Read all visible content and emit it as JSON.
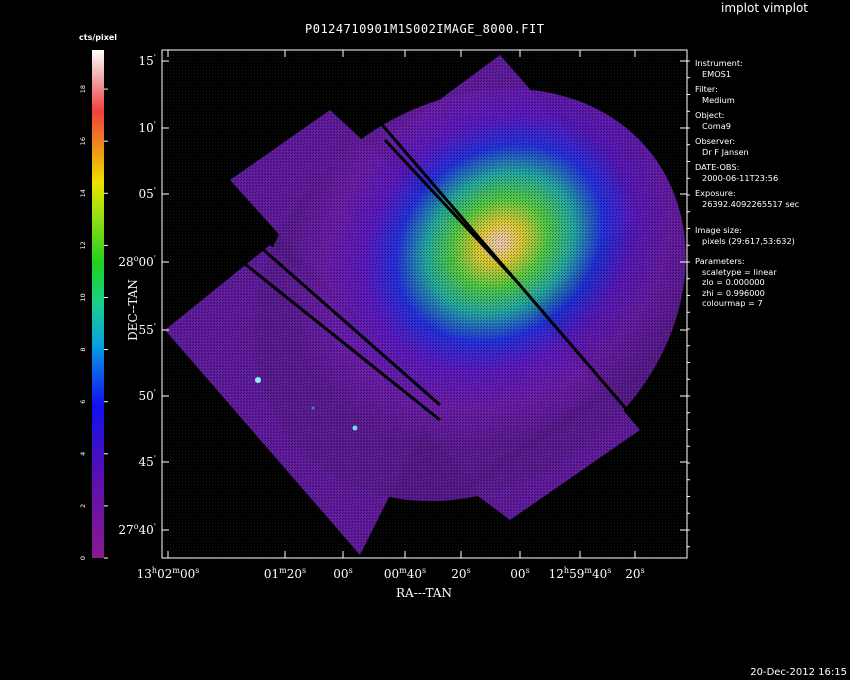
{
  "app_title": "implot vimplot",
  "plot_title": "P0124710901M1S002IMAGE_8000.FIT",
  "footer_date": "20-Dec-2012 16:15",
  "colorbar": {
    "label": "cts/pixel",
    "ticks": [
      "0",
      "2",
      "4",
      "6",
      "8",
      "10",
      "12",
      "14",
      "16",
      "18"
    ],
    "range": [
      0,
      19.5
    ]
  },
  "info": [
    {
      "key": "Instrument:",
      "values": [
        "EMOS1"
      ]
    },
    {
      "key": "Filter:",
      "values": [
        "Medium"
      ]
    },
    {
      "key": "Object:",
      "values": [
        "Coma9"
      ]
    },
    {
      "key": "Observer:",
      "values": [
        "Dr F Jansen"
      ]
    },
    {
      "key": "DATE-OBS:",
      "values": [
        "2000-06-11T23:56"
      ]
    },
    {
      "key": "Exposure:",
      "values": [
        "26392.4092265517 sec"
      ]
    },
    {
      "key": "Image size:",
      "values": [
        "pixels (29:617,53:632)"
      ]
    },
    {
      "key": "Parameters:",
      "values": [
        "scaletype = linear",
        "zlo = 0.000000",
        "zhi = 0.996000",
        "colourmap =   7"
      ]
    }
  ],
  "chart_data": {
    "type": "heatmap",
    "title": "P0124710901M1S002IMAGE_8000.FIT",
    "xlabel": "RA---TAN",
    "ylabel": "DEC--TAN",
    "colormap": "colourmap 7 (purple-blue-cyan-green-yellow-red-white)",
    "scale": "linear",
    "zlim": [
      0.0,
      0.996
    ],
    "x_ticks": [
      {
        "pre": "13",
        "sup1": "h",
        "mid": "02",
        "sup2": "m",
        "post": "00",
        "sup3": "s"
      },
      {
        "pre": "01",
        "sup1": "m",
        "mid": "20",
        "sup2": "s",
        "post": "",
        "sup3": ""
      },
      {
        "pre": "00",
        "sup1": "s",
        "mid": "",
        "sup2": "",
        "post": "",
        "sup3": ""
      },
      {
        "pre": "00",
        "sup1": "m",
        "mid": "40",
        "sup2": "s",
        "post": "",
        "sup3": ""
      },
      {
        "pre": "20",
        "sup1": "s",
        "mid": "",
        "sup2": "",
        "post": "",
        "sup3": ""
      },
      {
        "pre": "00",
        "sup1": "s",
        "mid": "",
        "sup2": "",
        "post": "",
        "sup3": ""
      },
      {
        "pre": "12",
        "sup1": "h",
        "mid": "59",
        "sup2": "m",
        "post": "40",
        "sup3": "s"
      },
      {
        "pre": "20",
        "sup1": "s",
        "mid": "",
        "sup2": "",
        "post": "",
        "sup3": ""
      }
    ],
    "y_ticks": [
      {
        "pre": "15",
        "sup1": "'",
        "mid": "",
        "sup2": "",
        "post": ""
      },
      {
        "pre": "10",
        "sup1": "'",
        "mid": "",
        "sup2": "",
        "post": ""
      },
      {
        "pre": "05",
        "sup1": "'",
        "mid": "",
        "sup2": "",
        "post": ""
      },
      {
        "pre": "28",
        "sup1": "o",
        "mid": "00",
        "sup2": "'",
        "post": ""
      },
      {
        "pre": "55",
        "sup1": "'",
        "mid": "",
        "sup2": "",
        "post": ""
      },
      {
        "pre": "50",
        "sup1": "'",
        "mid": "",
        "sup2": "",
        "post": ""
      },
      {
        "pre": "45",
        "sup1": "'",
        "mid": "",
        "sup2": "",
        "post": ""
      },
      {
        "pre": "27",
        "sup1": "o",
        "mid": "40",
        "sup2": "'",
        "post": ""
      }
    ]
  }
}
